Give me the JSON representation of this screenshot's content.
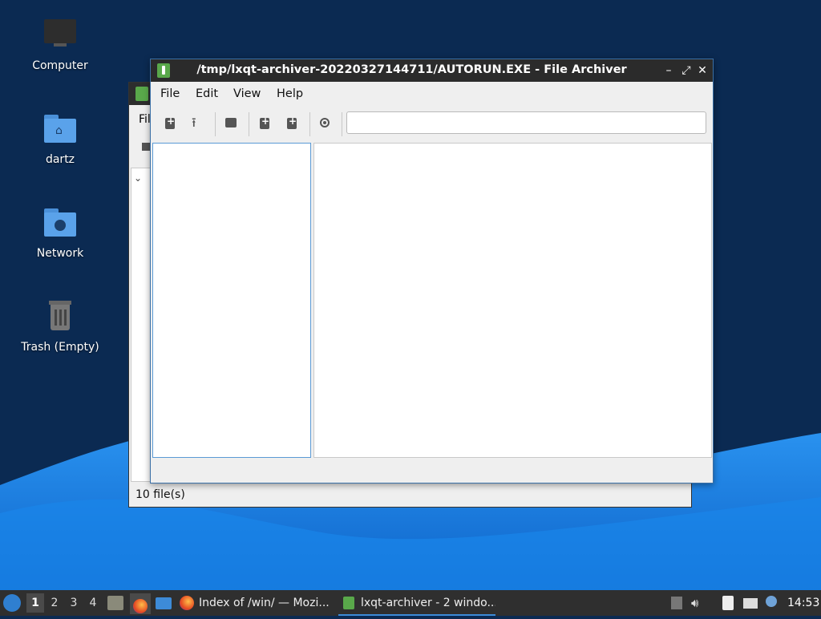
{
  "desktop": {
    "icons": [
      {
        "label": "Computer"
      },
      {
        "label": "dartz"
      },
      {
        "label": "Network"
      },
      {
        "label": "Trash (Empty)"
      }
    ]
  },
  "back_window": {
    "menu_partial": "Fil",
    "status": "10 file(s)"
  },
  "front_window": {
    "title": "/tmp/lxqt-archiver-20220327144711/AUTORUN.EXE - File Archiver",
    "menu": {
      "file": "File",
      "edit": "Edit",
      "view": "View",
      "help": "Help"
    },
    "search": {
      "value": ""
    }
  },
  "taskbar": {
    "workspaces": [
      "1",
      "2",
      "3",
      "4"
    ],
    "active_workspace": "1",
    "tasks": [
      {
        "label": "Index of /win/ — Mozi..."
      },
      {
        "label": "lxqt-archiver - 2 windo..."
      }
    ],
    "clock": "14:53"
  },
  "colors": {
    "wallpaper_dark": "#0b2a52",
    "wallpaper_wave": "#1e7fe0",
    "accent": "#3d8bd8",
    "titlebar": "#2b2b2b"
  }
}
